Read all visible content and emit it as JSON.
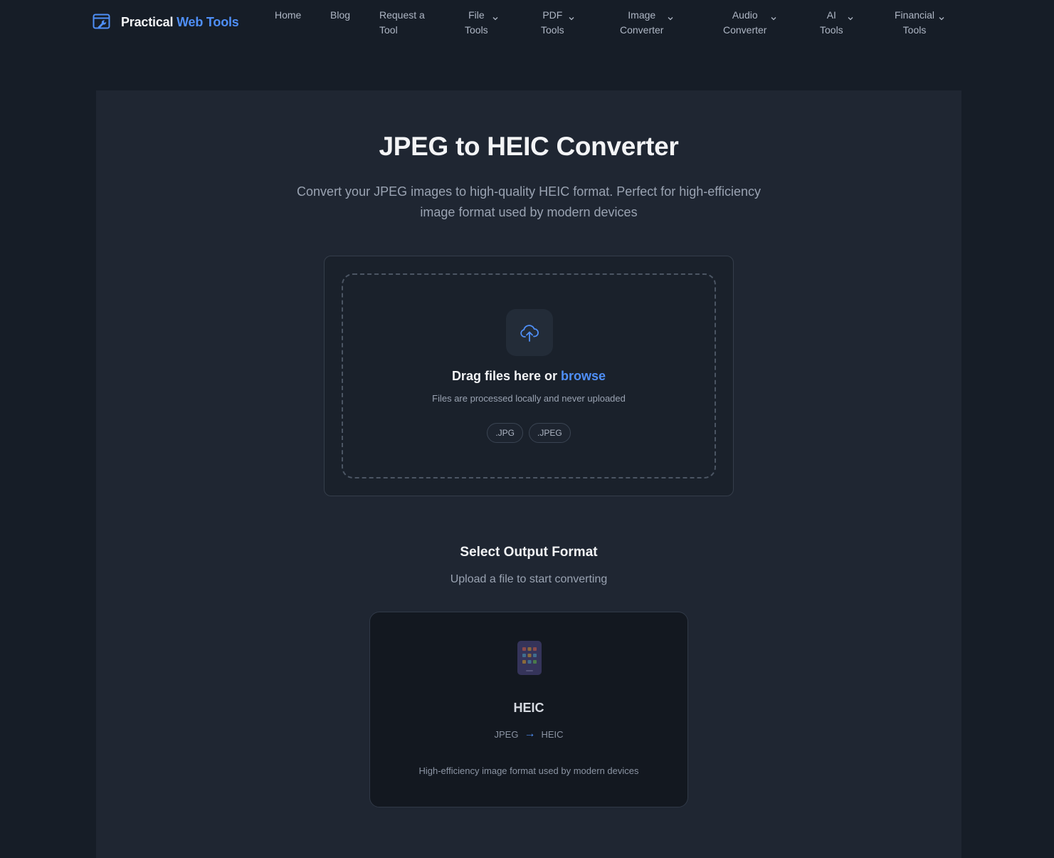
{
  "brand": {
    "name": "Practical",
    "accent": "Web Tools",
    "logo_icon": "wrench-window-icon"
  },
  "nav": {
    "home": "Home",
    "blog": "Blog",
    "request_line1": "Request a",
    "request_line2": "Tool",
    "file_line1": "File",
    "file_line2": "Tools",
    "pdf_line1": "PDF",
    "pdf_line2": "Tools",
    "image_line1": "Image",
    "image_line2": "Converter",
    "audio_line1": "Audio",
    "audio_line2": "Converter",
    "ai_line1": "AI",
    "ai_line2": "Tools",
    "financial_line1": "Financial",
    "financial_line2": "Tools"
  },
  "page": {
    "title": "JPEG to HEIC Converter",
    "subtitle_line1": "Convert your JPEG images to high-quality HEIC format. Perfect for high-efficiency",
    "subtitle_line2": "image format used by modern devices"
  },
  "upload": {
    "icon": "cloud-upload-icon",
    "drag_text": "Drag files here or",
    "browse_label": "browse",
    "note": "Files are processed locally and never uploaded",
    "formats": [
      ".JPG",
      ".JPEG"
    ]
  },
  "output": {
    "title": "Select Output Format",
    "subtitle": "Upload a file to start converting",
    "format": {
      "icon": "phone-apps-icon",
      "name": "HEIC",
      "from": "JPEG",
      "arrow": "→",
      "to": "HEIC",
      "description": "High-efficiency image format used by modern devices"
    }
  },
  "colors": {
    "accent": "#4f8ff7",
    "background": "#161d27",
    "panel": "#1f2632"
  }
}
